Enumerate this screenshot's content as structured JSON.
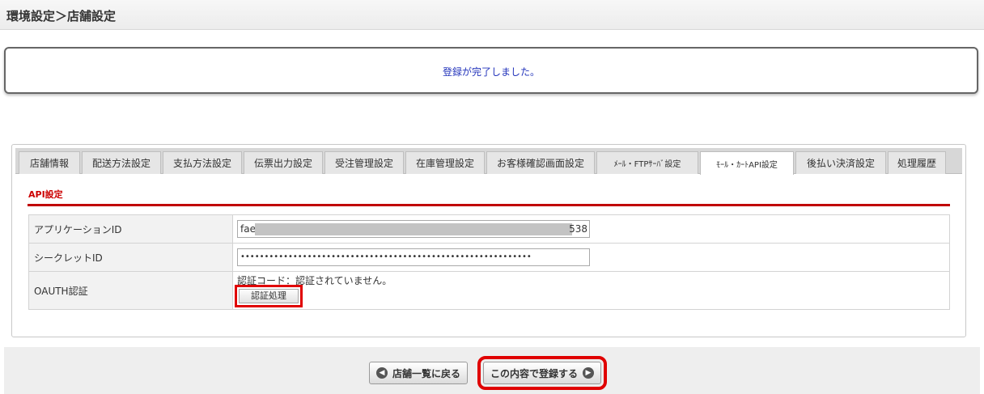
{
  "header": {
    "title": "環境設定＞店舗設定"
  },
  "message": {
    "text": "登録が完了しました。"
  },
  "tabs": [
    {
      "label": "店舗情報",
      "active": false
    },
    {
      "label": "配送方法設定",
      "active": false
    },
    {
      "label": "支払方法設定",
      "active": false
    },
    {
      "label": "伝票出力設定",
      "active": false
    },
    {
      "label": "受注管理設定",
      "active": false
    },
    {
      "label": "在庫管理設定",
      "active": false
    },
    {
      "label": "お客様確認画面設定",
      "active": false
    },
    {
      "label": "ﾒｰﾙ・FTPｻｰﾊﾞ設定",
      "active": false
    },
    {
      "label": "ﾓｰﾙ・ｶｰﾄAPI設定",
      "active": true
    },
    {
      "label": "後払い決済設定",
      "active": false
    },
    {
      "label": "処理履歴",
      "active": false
    }
  ],
  "section": {
    "title": "API設定"
  },
  "form": {
    "app_id_label": "アプリケーションID",
    "app_id_prefix": "fae",
    "app_id_suffix": "538",
    "secret_label": "シークレットID",
    "secret_value": "•••••••••••••••••••••••••••••••••••••••••••••••••••••••••••••",
    "oauth_label": "OAUTH認証",
    "oauth_status": "認証コード：認証されていません。",
    "oauth_button": "認証処理"
  },
  "footer": {
    "back_label": "店舗一覧に戻る",
    "save_label": "この内容で登録する"
  },
  "colors": {
    "accent_red": "#cc0000",
    "message_blue": "#2233bb",
    "highlight_red": "#e00000"
  }
}
